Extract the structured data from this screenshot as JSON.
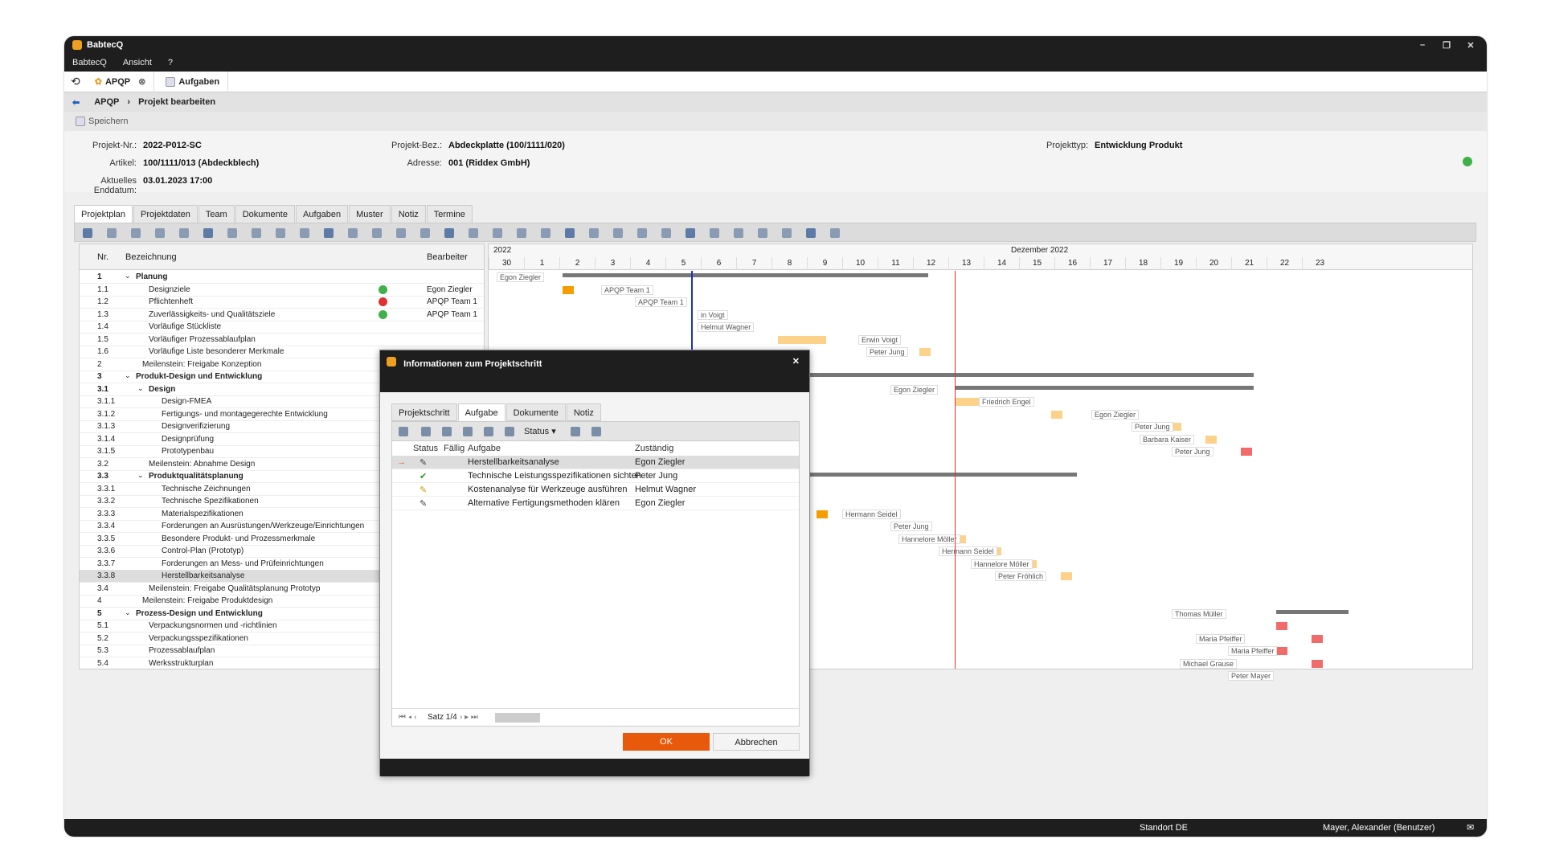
{
  "app": {
    "title": "BabtecQ",
    "menu": [
      "BabtecQ",
      "Ansicht",
      "?"
    ]
  },
  "tabs": [
    {
      "label": "APQP"
    },
    {
      "label": "Aufgaben"
    }
  ],
  "breadcrumb": {
    "root": "APQP",
    "current": "Projekt bearbeiten"
  },
  "toolbar": {
    "save": "Speichern"
  },
  "project": {
    "nr_label": "Projekt-Nr.:",
    "nr": "2022-P012-SC",
    "artikel_label": "Artikel:",
    "artikel": "100/1111/013 (Abdeckblech)",
    "enddatum_label": "Aktuelles Enddatum:",
    "enddatum": "03.01.2023 17:00",
    "bez_label": "Projekt-Bez.:",
    "bez": "Abdeckplatte (100/1111/020)",
    "adresse_label": "Adresse:",
    "adresse": "001 (Riddex GmbH)",
    "typ_label": "Projekttyp:",
    "typ": "Entwicklung Produkt"
  },
  "subtabs": [
    "Projektplan",
    "Projektdaten",
    "Team",
    "Dokumente",
    "Aufgaben",
    "Muster",
    "Notiz",
    "Termine"
  ],
  "grid": {
    "col_nr": "Nr.",
    "col_bez": "Bezeichnung",
    "col_bearbeiter": "Bearbeiter",
    "rows": [
      {
        "nr": "1",
        "bez": "Planung",
        "lvl": 0,
        "bold": true,
        "bearb": ""
      },
      {
        "nr": "1.1",
        "bez": "Designziele",
        "lvl": 1,
        "bearb": "Egon Ziegler",
        "status": "green"
      },
      {
        "nr": "1.2",
        "bez": "Pflichtenheft",
        "lvl": 1,
        "bearb": "APQP Team 1",
        "status": "red"
      },
      {
        "nr": "1.3",
        "bez": "Zuverlässigkeits- und Qualitätsziele",
        "lvl": 1,
        "bearb": "APQP Team 1",
        "status": "green"
      },
      {
        "nr": "1.4",
        "bez": "Vorläufige Stückliste",
        "lvl": 1
      },
      {
        "nr": "1.5",
        "bez": "Vorläufiger Prozessablaufplan",
        "lvl": 1
      },
      {
        "nr": "1.6",
        "bez": "Vorläufige Liste besonderer Merkmale",
        "lvl": 1
      },
      {
        "nr": "2",
        "bez": "Meilenstein: Freigabe Konzeption",
        "lvl": 0.5
      },
      {
        "nr": "3",
        "bez": "Produkt-Design und Entwicklung",
        "lvl": 0,
        "bold": true
      },
      {
        "nr": "3.1",
        "bez": "Design",
        "lvl": 1,
        "bold": true
      },
      {
        "nr": "3.1.1",
        "bez": "Design-FMEA",
        "lvl": 2
      },
      {
        "nr": "3.1.2",
        "bez": "Fertigungs- und montagegerechte Entwicklung",
        "lvl": 2
      },
      {
        "nr": "3.1.3",
        "bez": "Designverifizierung",
        "lvl": 2
      },
      {
        "nr": "3.1.4",
        "bez": "Designprüfung",
        "lvl": 2
      },
      {
        "nr": "3.1.5",
        "bez": "Prototypenbau",
        "lvl": 2
      },
      {
        "nr": "3.2",
        "bez": "Meilenstein: Abnahme Design",
        "lvl": 1
      },
      {
        "nr": "3.3",
        "bez": "Produktqualitätsplanung",
        "lvl": 1,
        "bold": true
      },
      {
        "nr": "3.3.1",
        "bez": "Technische Zeichnungen",
        "lvl": 2
      },
      {
        "nr": "3.3.2",
        "bez": "Technische Spezifikationen",
        "lvl": 2
      },
      {
        "nr": "3.3.3",
        "bez": "Materialspezifikationen",
        "lvl": 2
      },
      {
        "nr": "3.3.4",
        "bez": "Forderungen an Ausrüstungen/Werkzeuge/Einrichtungen",
        "lvl": 2
      },
      {
        "nr": "3.3.5",
        "bez": "Besondere Produkt- und Prozessmerkmale",
        "lvl": 2
      },
      {
        "nr": "3.3.6",
        "bez": "Control-Plan (Prototyp)",
        "lvl": 2
      },
      {
        "nr": "3.3.7",
        "bez": "Forderungen an Mess- und Prüfeinrichtungen",
        "lvl": 2
      },
      {
        "nr": "3.3.8",
        "bez": "Herstellbarkeitsanalyse",
        "lvl": 2,
        "sel": true
      },
      {
        "nr": "3.4",
        "bez": "Meilenstein: Freigabe Qualitätsplanung Prototyp",
        "lvl": 1
      },
      {
        "nr": "4",
        "bez": "Meilenstein: Freigabe Produktdesign",
        "lvl": 0.5
      },
      {
        "nr": "5",
        "bez": "Prozess-Design und Entwicklung",
        "lvl": 0,
        "bold": true
      },
      {
        "nr": "5.1",
        "bez": "Verpackungsnormen und -richtlinien",
        "lvl": 1
      },
      {
        "nr": "5.2",
        "bez": "Verpackungsspezifikationen",
        "lvl": 1
      },
      {
        "nr": "5.3",
        "bez": "Prozessablaufplan",
        "lvl": 1
      },
      {
        "nr": "5.4",
        "bez": "Werksstrukturplan",
        "lvl": 1,
        "bearb": "Peter Mayer"
      }
    ]
  },
  "gantt": {
    "year": "2022",
    "month": "Dezember 2022",
    "days": [
      "30",
      "1",
      "2",
      "3",
      "4",
      "5",
      "6",
      "7",
      "8",
      "9",
      "10",
      "11",
      "12",
      "13",
      "14",
      "15",
      "16",
      "17",
      "18",
      "19",
      "20",
      "21",
      "22",
      "23"
    ],
    "labels": [
      "Egon Ziegler",
      "APQP Team 1",
      "APQP Team 1",
      "in Voigt",
      "Helmut Wagner",
      "Erwin Voigt",
      "Peter Jung",
      "Egon Ziegler",
      "Friedrich Engel",
      "Egon Ziegler",
      "Peter Jung",
      "Barbara Kaiser",
      "Peter Jung",
      "Peter Fröhlich",
      "Hannelore Möller",
      "Hermann Seidel",
      "Peter Jung",
      "Hannelore Möller",
      "Hermann Seidel",
      "Hannelore Möller",
      "Peter Fröhlich",
      "Thomas Müller",
      "Maria Pfeiffer",
      "Maria Pfeiffer",
      "Michael Grause",
      "Peter Mayer"
    ]
  },
  "dialog": {
    "title": "Informationen zum Projektschritt",
    "tabs": [
      "Projektschritt",
      "Aufgabe",
      "Dokumente",
      "Notiz"
    ],
    "status_btn": "Status",
    "cols": {
      "status": "Status",
      "faellig": "Fällig",
      "aufgabe": "Aufgabe",
      "zustaendig": "Zuständig"
    },
    "rows": [
      {
        "aufgabe": "Herstellbarkeitsanalyse",
        "zustaendig": "Egon Ziegler"
      },
      {
        "aufgabe": "Technische Leistungsspezifikationen sichten",
        "zustaendig": "Peter Jung"
      },
      {
        "aufgabe": "Kostenanalyse für Werkzeuge ausführen",
        "zustaendig": "Helmut Wagner"
      },
      {
        "aufgabe": "Alternative Fertigungsmethoden klären",
        "zustaendig": "Egon Ziegler"
      }
    ],
    "pager": "Satz 1/4",
    "ok": "OK",
    "cancel": "Abbrechen"
  },
  "statusbar": {
    "standort": "Standort DE",
    "user": "Mayer, Alexander (Benutzer)"
  }
}
